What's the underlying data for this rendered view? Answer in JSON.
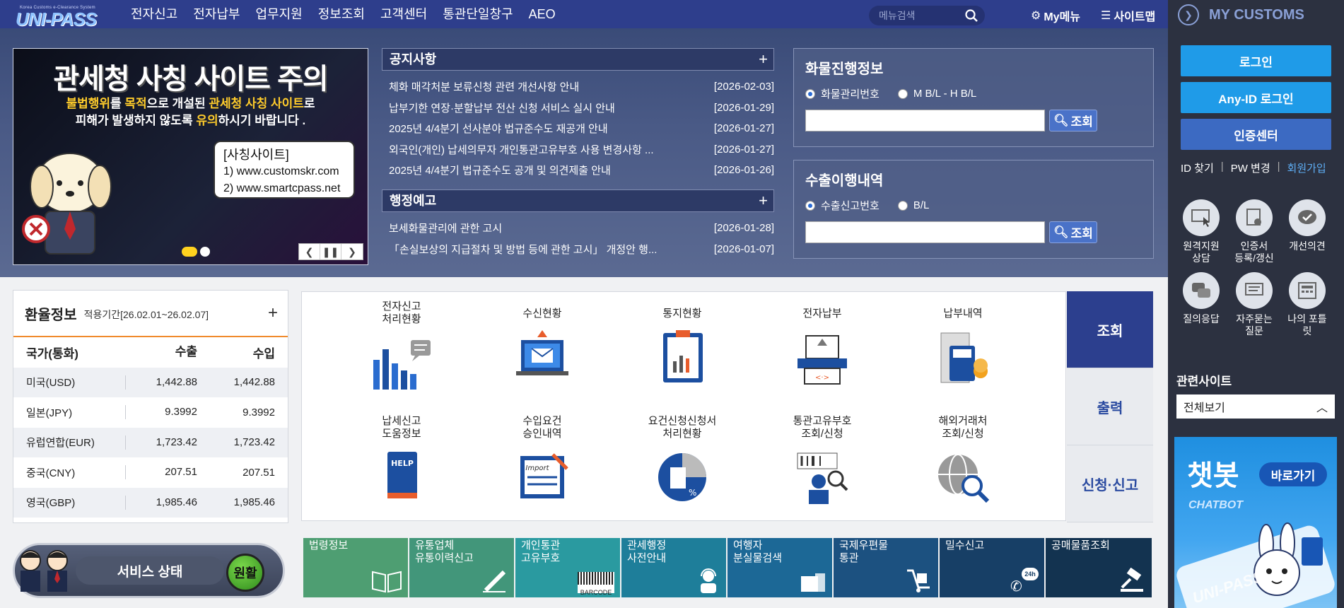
{
  "header": {
    "logo_small": "Korea Customs e-Clearance System",
    "logo": "UNI-PASS",
    "menu": [
      "전자신고",
      "전자납부",
      "업무지원",
      "정보조회",
      "고객센터",
      "통관단일창구",
      "AEO"
    ],
    "search_placeholder": "메뉴검색",
    "mymenu": "My메뉴",
    "sitemap": "사이트맵"
  },
  "banner": {
    "title": "관세청 사칭 사이트 주의",
    "line1_pre": "불법행위",
    "line1_mid": "를 ",
    "line1_y": "목적",
    "line1_post": "으로 개설된 ",
    "line1_y2": "관세청 사칭 사이트",
    "line1_end": "로",
    "line2_pre": "피해가 발생하지 않도록 ",
    "line2_y": "유의",
    "line2_post": "하시기 바랍니다 .",
    "box_title": "[사칭사이트]",
    "box_1": "1) www.customskr.com",
    "box_2": "2) www.smartcpass.net"
  },
  "notices": {
    "title": "공지사항",
    "items": [
      {
        "title": "체화 매각처분 보류신청 관련 개선사항 안내",
        "date": "[2026-02-03]"
      },
      {
        "title": "납부기한 연장·분할납부 전산 신청 서비스 실시 안내",
        "date": "[2026-01-29]"
      },
      {
        "title": "2025년 4/4분기 선사분야 법규준수도 재공개 안내",
        "date": "[2026-01-27]"
      },
      {
        "title": "외국인(개인) 납세의무자 개인통관고유부호 사용 변경사항 ...",
        "date": "[2026-01-27]"
      },
      {
        "title": "2025년 4/4분기 법규준수도 공개 및 의견제출 안내",
        "date": "[2026-01-26]"
      }
    ]
  },
  "admin": {
    "title": "행정예고",
    "items": [
      {
        "title": "보세화물관리에 관한 고시",
        "date": "[2026-01-28]"
      },
      {
        "title": "「손실보상의 지급절차 및 방법 등에 관한 고시」 개정안 행...",
        "date": "[2026-01-07]"
      }
    ]
  },
  "cargo": {
    "title": "화물진행정보",
    "opt1": "화물관리번호",
    "opt2": "M B/L - H B/L",
    "btn": "조회"
  },
  "export": {
    "title": "수출이행내역",
    "opt1": "수출신고번호",
    "opt2": "B/L",
    "btn": "조회"
  },
  "sidebar": {
    "title": "MY CUSTOMS",
    "login": "로그인",
    "anyid": "Any-ID 로그인",
    "cert": "인증센터",
    "find_id": "ID 찾기",
    "pw": "PW 변경",
    "join": "회원가입",
    "icons": [
      {
        "l1": "원격지원",
        "l2": "상담"
      },
      {
        "l1": "인증서",
        "l2": "등록/갱신"
      },
      {
        "l1": "개선의견",
        "l2": ""
      },
      {
        "l1": "질의응답",
        "l2": ""
      },
      {
        "l1": "자주묻는",
        "l2": "질문"
      },
      {
        "l1": "나의 포틀",
        "l2": "릿"
      }
    ],
    "related": "관련사이트",
    "related_sel": "전체보기",
    "chat_title": "챗봇",
    "chat_sub": "CHATBOT",
    "chat_go": "바로가기",
    "chat_brand": "UNI-PASS"
  },
  "fx": {
    "title": "환율정보",
    "period": "적용기간[26.02.01~26.02.07]",
    "headers": [
      "국가(통화)",
      "수출",
      "수입"
    ],
    "rows": [
      [
        "미국(USD)",
        "1,442.88",
        "1,442.88"
      ],
      [
        "일본(JPY)",
        "9.3992",
        "9.3992"
      ],
      [
        "유럽연합(EUR)",
        "1,723.42",
        "1,723.42"
      ],
      [
        "중국(CNY)",
        "207.51",
        "207.51"
      ],
      [
        "영국(GBP)",
        "1,985.46",
        "1,985.46"
      ]
    ]
  },
  "services": [
    {
      "l1": "전자신고",
      "l2": "처리현황"
    },
    {
      "l1": "수신현황",
      "l2": ""
    },
    {
      "l1": "통지현황",
      "l2": ""
    },
    {
      "l1": "전자납부",
      "l2": ""
    },
    {
      "l1": "납부내역",
      "l2": ""
    },
    {
      "l1": "납세신고",
      "l2": "도움정보"
    },
    {
      "l1": "수입요건",
      "l2": "승인내역"
    },
    {
      "l1": "요건신청신청서",
      "l2": "처리현황"
    },
    {
      "l1": "통관고유부호",
      "l2": "조회/신청"
    },
    {
      "l1": "해외거래처",
      "l2": "조회/신청"
    }
  ],
  "tabs": [
    "조회",
    "출력",
    "신청·신고"
  ],
  "status": {
    "label": "서비스 상태",
    "value": "원활"
  },
  "tiles": [
    {
      "l1": "법령정보",
      "l2": "",
      "color": "#4e9e72"
    },
    {
      "l1": "유통업체",
      "l2": "유통이력신고",
      "color": "#42967a"
    },
    {
      "l1": "개인통관",
      "l2": "고유부호",
      "color": "#2a9aa0",
      "extra": "BARCODE"
    },
    {
      "l1": "관세행정",
      "l2": "사전안내",
      "color": "#1e7e9a"
    },
    {
      "l1": "여행자",
      "l2": "분실물검색",
      "color": "#1c6896"
    },
    {
      "l1": "국제우편물",
      "l2": "통관",
      "color": "#1c5180"
    },
    {
      "l1": "밀수신고",
      "l2": "",
      "color": "#173f66",
      "extra": "24h"
    },
    {
      "l1": "공매물품조회",
      "l2": "",
      "color": "#133350"
    }
  ]
}
